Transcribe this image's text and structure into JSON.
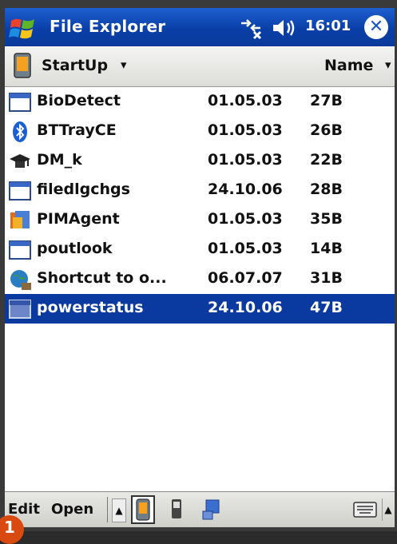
{
  "titlebar": {
    "title": "File Explorer",
    "time": "16:01",
    "close_label": "✕",
    "icons": [
      "windows-start-icon",
      "connectivity-icon",
      "volume-icon",
      "close-icon"
    ]
  },
  "folderbar": {
    "folder": "StartUp",
    "sort": "Name"
  },
  "files": [
    {
      "name": "BioDetect",
      "date": "01.05.03",
      "size": "27B",
      "icon": "app-window-icon"
    },
    {
      "name": "BTTrayCE",
      "date": "01.05.03",
      "size": "26B",
      "icon": "bluetooth-icon"
    },
    {
      "name": "DM_k",
      "date": "01.05.03",
      "size": "22B",
      "icon": "graduation-cap-icon"
    },
    {
      "name": "filedlgchgs",
      "date": "24.10.06",
      "size": "28B",
      "icon": "app-window-icon"
    },
    {
      "name": "PIMAgent",
      "date": "01.05.03",
      "size": "35B",
      "icon": "pim-agent-icon"
    },
    {
      "name": "poutlook",
      "date": "01.05.03",
      "size": "14B",
      "icon": "app-window-icon"
    },
    {
      "name": "Shortcut to o...",
      "date": "06.07.07",
      "size": "31B",
      "icon": "globe-shortcut-icon"
    },
    {
      "name": "powerstatus",
      "date": "24.10.06",
      "size": "47B",
      "icon": "app-window-icon",
      "selected": true
    }
  ],
  "menubar": {
    "edit": "Edit",
    "open": "Open"
  },
  "badge": {
    "number": "1"
  },
  "colors": {
    "titlebar": "#0b3fa8",
    "selection": "#0a3aa0"
  }
}
